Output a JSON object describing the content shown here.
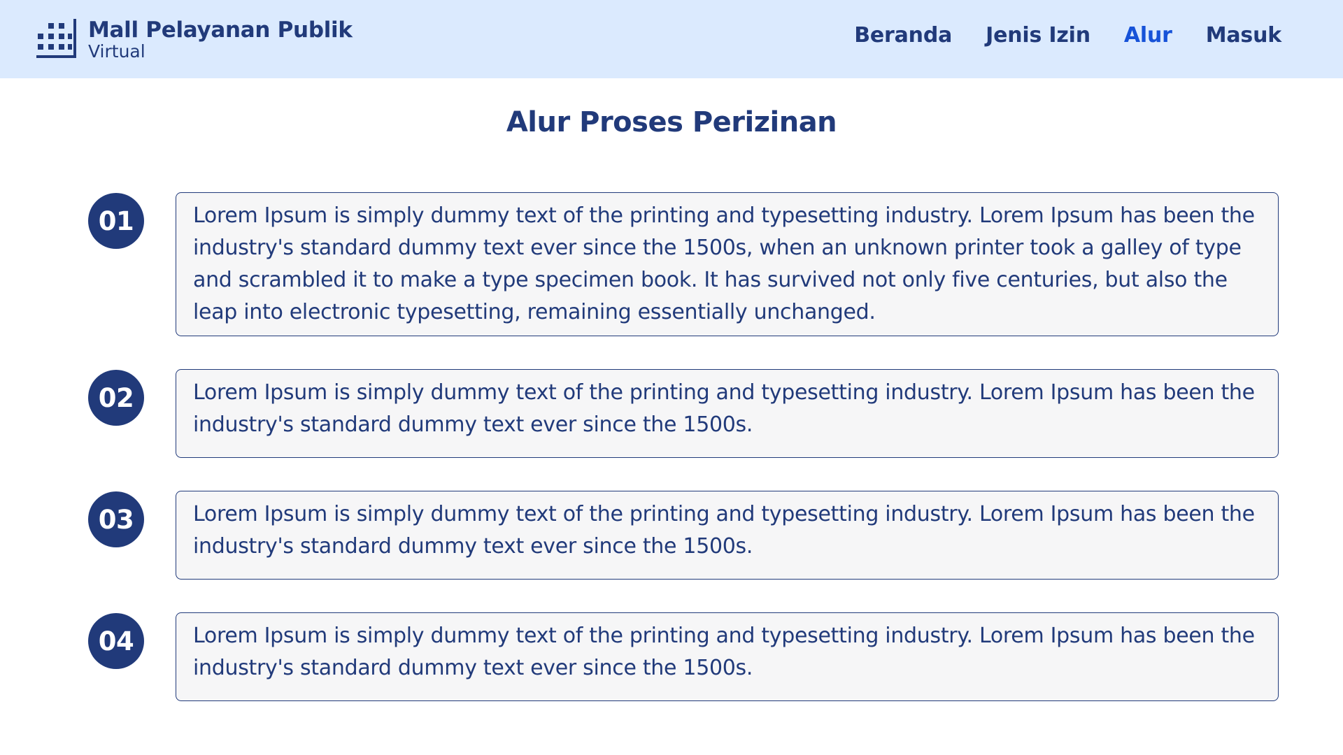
{
  "header": {
    "logo_title": "Mall Pelayanan Publik",
    "logo_subtitle": "Virtual",
    "logo_icon": "building-grid-icon",
    "nav": [
      {
        "label": "Beranda",
        "active": false
      },
      {
        "label": "Jenis Izin",
        "active": false
      },
      {
        "label": "Alur",
        "active": true
      },
      {
        "label": "Masuk",
        "active": false
      }
    ]
  },
  "main": {
    "title": "Alur Proses Perizinan",
    "steps": [
      {
        "number": "01",
        "text": "Lorem Ipsum is simply dummy text of the printing and typesetting industry. Lorem Ipsum has been the industry's standard dummy text ever since the 1500s, when an unknown printer took a galley of type and scrambled it to make a type specimen book. It has survived not only five centuries, but also the leap into electronic typesetting, remaining essentially unchanged."
      },
      {
        "number": "02",
        "text": "Lorem Ipsum is simply dummy text of the printing and typesetting industry. Lorem Ipsum has been the industry's standard dummy text ever since the 1500s."
      },
      {
        "number": "03",
        "text": "Lorem Ipsum is simply dummy text of the printing and typesetting industry. Lorem Ipsum has been the industry's standard dummy text ever since the 1500s."
      },
      {
        "number": "04",
        "text": "Lorem Ipsum is simply dummy text of the printing and typesetting industry. Lorem Ipsum has been the industry's standard dummy text ever since the 1500s."
      }
    ]
  },
  "colors": {
    "header_bg": "#dbeafe",
    "primary": "#213a7a",
    "active_link": "#1652d8",
    "card_bg": "#f6f6f7"
  }
}
